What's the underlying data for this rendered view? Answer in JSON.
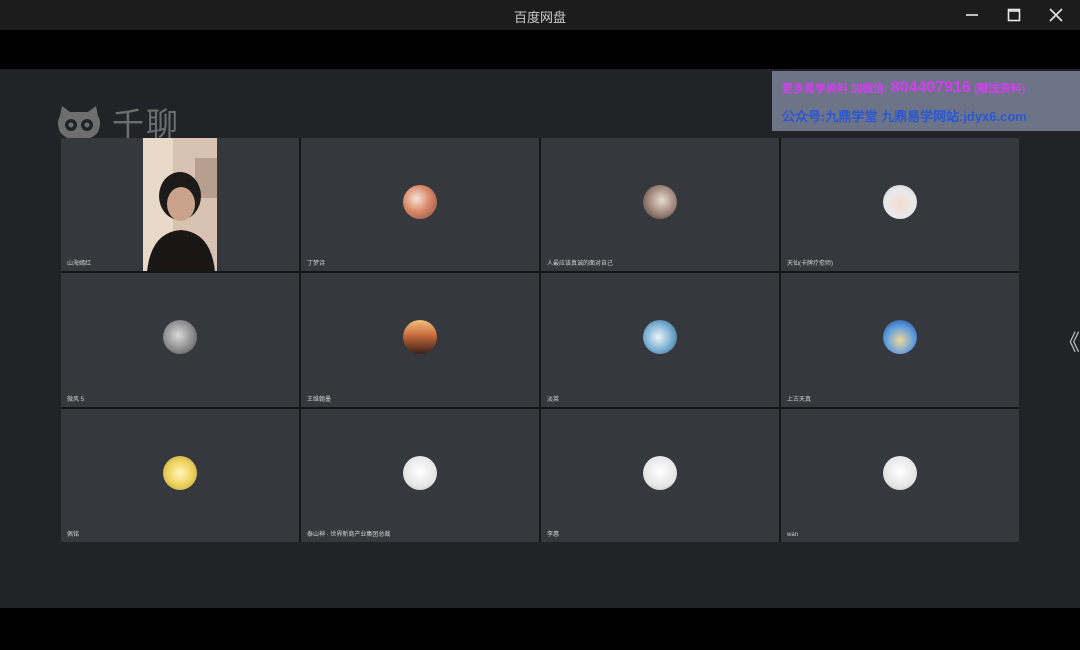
{
  "window": {
    "title": "百度网盘",
    "controls": [
      "minimize-icon",
      "maximize-icon",
      "close-icon"
    ]
  },
  "logo": {
    "text": "千聊"
  },
  "watermark": {
    "line1_prefix": "更多易学资料 加微信:",
    "line1_number": "804407916",
    "line1_suffix": "(赠送资料)",
    "line2": "公众号:九鼎学堂 九鼎易学网站:jdyx6.com"
  },
  "participants": [
    {
      "name": "山海嫣红"
    },
    {
      "name": "丁梦诗"
    },
    {
      "name": "人最应该真诚的面对自己"
    },
    {
      "name": "天仙(卡牌疗愈师)"
    },
    {
      "name": "微风 5"
    },
    {
      "name": "王维翰墨"
    },
    {
      "name": "淡菜"
    },
    {
      "name": "上古天真"
    },
    {
      "name": "佩铭"
    },
    {
      "name": "泰山神 · 世界新商产业集团总裁"
    },
    {
      "name": "李惠"
    },
    {
      "name": "wan"
    }
  ],
  "colors": {
    "titlebar": "#1c1c1c",
    "tile": "#35383d",
    "watermark_bg": "#7880a0",
    "watermark_pink": "#d43df0",
    "watermark_blue": "#2a58d4"
  },
  "nav": {
    "next_arrow": "《"
  }
}
